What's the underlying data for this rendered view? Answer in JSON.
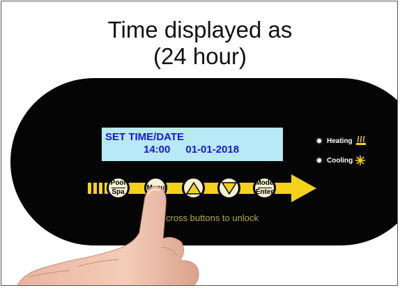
{
  "caption": {
    "line1": "Time displayed as",
    "line2": "(24 hour)"
  },
  "lcd": {
    "title": "SET TIME/DATE",
    "time": "14:00",
    "date": "01-01-2018"
  },
  "indicators": [
    {
      "label": "Heating",
      "icon": "heating-icon"
    },
    {
      "label": "Cooling",
      "icon": "snowflake-icon"
    }
  ],
  "buttons": {
    "pool_spa": {
      "top": "Pool",
      "bottom": "Spa"
    },
    "menu": "Menu",
    "up": "up-triangle-icon",
    "down": "down-triangle-icon",
    "mode_enter": {
      "top": "Mode",
      "bottom": "Enter"
    }
  },
  "hint": "cross buttons to unlock",
  "colors": {
    "panel": "#050505",
    "lcd": "#b7e9f7",
    "lcd_text": "#1616d8",
    "accent": "#f4d21a"
  }
}
